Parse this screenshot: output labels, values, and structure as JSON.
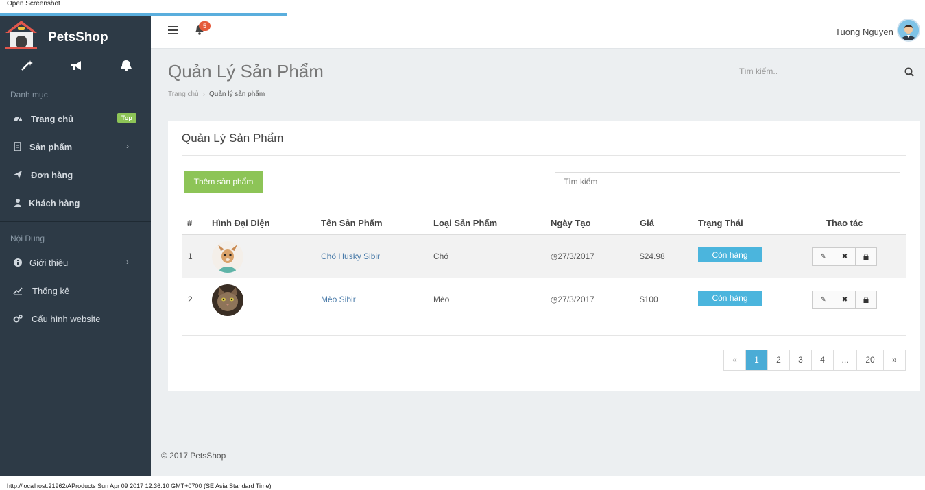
{
  "window": {
    "caption": "Open Screenshot"
  },
  "brand": {
    "name": "PetsShop"
  },
  "sidebar": {
    "section1": "Danh mục",
    "items1": [
      {
        "label": "Trang chủ",
        "badge": "Top"
      },
      {
        "label": "Sản phẩm"
      },
      {
        "label": "Đơn hàng"
      },
      {
        "label": "Khách hàng"
      }
    ],
    "section2": "Nội Dung",
    "items2": [
      {
        "label": "Giới thiệu"
      },
      {
        "label": "Thống kê"
      },
      {
        "label": "Cấu hình website"
      }
    ]
  },
  "topbar": {
    "notif_count": "5",
    "user_name": "Tuong Nguyen"
  },
  "page": {
    "title": "Quản Lý Sản Phẩm",
    "search_placeholder": "Tìm kiếm..",
    "breadcrumb": [
      "Trang chủ",
      "Quản lý sản phẩm"
    ]
  },
  "card": {
    "title": "Quản Lý Sản Phẩm",
    "add_button": "Thêm sản phẩm",
    "search_placeholder": "Tìm kiếm"
  },
  "table": {
    "headers": [
      "#",
      "Hình Đại Diện",
      "Tên Sản Phẩm",
      "Loại Sản Phẩm",
      "Ngày Tạo",
      "Giá",
      "Trạng Thái",
      "Thao tác"
    ],
    "rows": [
      {
        "num": "1",
        "name": "Chó Husky Sibir",
        "type": "Chó",
        "date": "27/3/2017",
        "price": "$24.98",
        "status": "Còn hàng"
      },
      {
        "num": "2",
        "name": "Mèo Sibir",
        "type": "Mèo",
        "date": "27/3/2017",
        "price": "$100",
        "status": "Còn hàng"
      }
    ]
  },
  "pagination": {
    "prev": "«",
    "pages": [
      "1",
      "2",
      "3",
      "4",
      "...",
      "20"
    ],
    "next": "»",
    "active": "1"
  },
  "footer": {
    "text": "© 2017 PetsShop"
  },
  "statusbar": {
    "text": "http://localhost:21962/AProducts Sun Apr 09 2017 12:36:10 GMT+0700 (SE Asia Standard Time)"
  },
  "colors": {
    "sidebar": "#2d3a46",
    "accent_green": "#8dc457",
    "accent_blue": "#4bb5dd",
    "badge_red": "#e55a3b"
  }
}
